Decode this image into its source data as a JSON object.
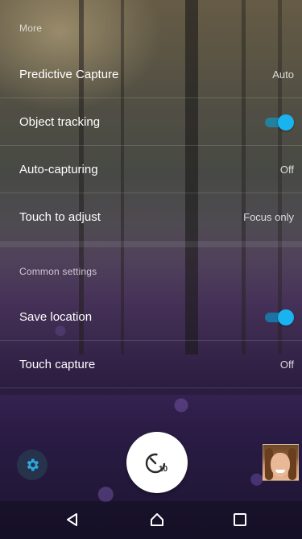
{
  "sections": {
    "more_title": "More",
    "common_title": "Common settings"
  },
  "settings": {
    "predictive_capture": {
      "label": "Predictive Capture",
      "value": "Auto"
    },
    "object_tracking": {
      "label": "Object tracking",
      "enabled": true
    },
    "auto_capturing": {
      "label": "Auto-capturing",
      "value": "Off"
    },
    "touch_to_adjust": {
      "label": "Touch to adjust",
      "value": "Focus only"
    },
    "save_location": {
      "label": "Save location",
      "enabled": true
    },
    "touch_capture": {
      "label": "Touch capture",
      "value": "Off"
    }
  },
  "camera": {
    "timer_value": "10",
    "settings_icon": "gear-icon",
    "shutter_icon": "self-timer-icon",
    "thumbnail": "last-photo-thumbnail"
  },
  "navbar": {
    "back_icon": "back-triangle-icon",
    "home_icon": "home-icon",
    "recents_icon": "recents-square-icon"
  },
  "colors": {
    "toggle_accent": "#19b3f0",
    "text_primary": "#ffffff"
  }
}
